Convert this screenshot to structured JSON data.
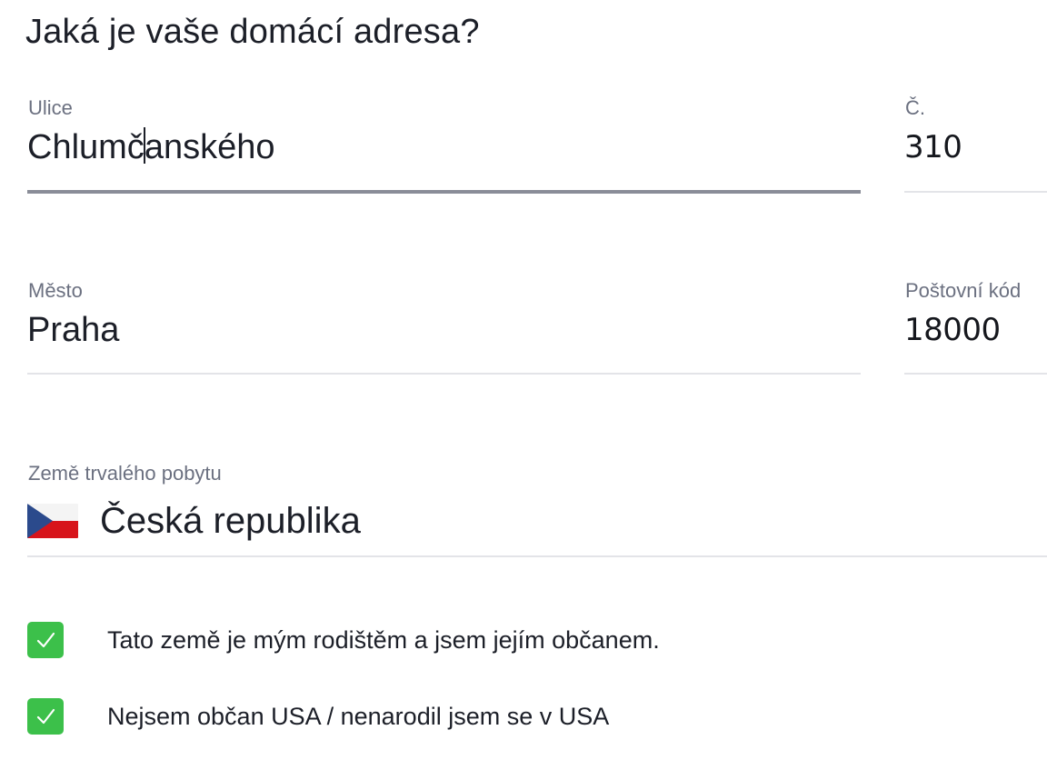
{
  "title": "Jaká je vaše domácí adresa?",
  "fields": {
    "street": {
      "label": "Ulice",
      "value_before_caret": "Chlumč",
      "value_after_caret": "anského"
    },
    "number": {
      "label": "Č.",
      "value": "310"
    },
    "city": {
      "label": "Město",
      "value": "Praha"
    },
    "postal": {
      "label": "Poštovní kód",
      "value": "18000"
    }
  },
  "country": {
    "label": "Země trvalého pobytu",
    "value": "Česká republika",
    "flag": "czech-flag"
  },
  "checkboxes": [
    {
      "label": "Tato země je mým rodištěm a jsem jejím občanem.",
      "checked": true
    },
    {
      "label": "Nejsem občan USA / nenarodil jsem se v USA",
      "checked": true
    }
  ],
  "colors": {
    "accent_check": "#3cc04a",
    "text": "#1c1f28",
    "label": "#6b7080",
    "active_underline": "#8a8d98"
  }
}
